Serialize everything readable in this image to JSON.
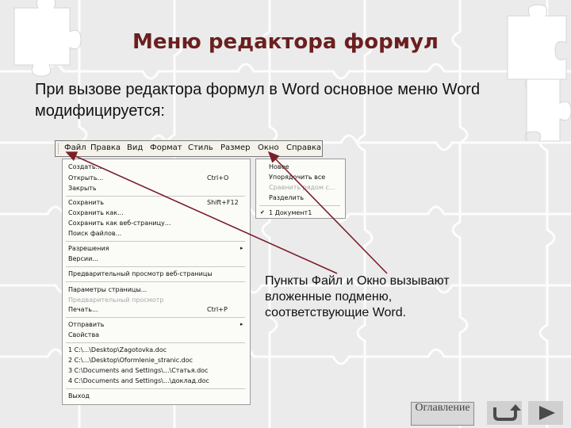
{
  "slide": {
    "title": "Меню редактора формул",
    "intro": "При вызове редактора формул в Word основное меню Word модифицируется:",
    "note": "Пункты Файл и Окно вызывают вложенные подменю, соответствующие Word.",
    "toc_label": "Оглавление",
    "accent_color": "#6b1f1f",
    "arrow_color": "#7a1f2a"
  },
  "menubar": {
    "items": [
      "Файл",
      "Правка",
      "Вид",
      "Формат",
      "Стиль",
      "Размер",
      "Окно",
      "Справка"
    ]
  },
  "file_menu": {
    "items": [
      {
        "label": "Создать..."
      },
      {
        "label": "Открыть...",
        "shortcut": "Ctrl+O"
      },
      {
        "label": "Закрыть"
      },
      {
        "label": "Сохранить",
        "shortcut": "Shift+F12"
      },
      {
        "label": "Сохранить как..."
      },
      {
        "label": "Сохранить как веб-страницу..."
      },
      {
        "label": "Поиск файлов..."
      },
      {
        "label": "Разрешения"
      },
      {
        "label": "Версии..."
      },
      {
        "label": "Предварительный просмотр веб-страницы"
      },
      {
        "label": "Параметры страницы..."
      },
      {
        "label": "Предварительный просмотр",
        "disabled": true
      },
      {
        "label": "Печать...",
        "shortcut": "Ctrl+P"
      },
      {
        "label": "Отправить"
      },
      {
        "label": "Свойства"
      },
      {
        "label": "1 C:\\...\\Desktop\\Zagotovka.doc"
      },
      {
        "label": "2 C:\\...\\Desktop\\Oformlenie_stranic.doc"
      },
      {
        "label": "3 C:\\Documents and Settings\\...\\Статья.doc"
      },
      {
        "label": "4 C:\\Documents and Settings\\...\\доклад.doc"
      },
      {
        "label": "Выход"
      }
    ]
  },
  "window_menu": {
    "items": [
      {
        "label": "Новое"
      },
      {
        "label": "Упорядочить все"
      },
      {
        "label": "Сравнить рядом с...",
        "disabled": true
      },
      {
        "label": "Разделить"
      },
      {
        "label": "1 Документ1",
        "checked": true
      }
    ]
  },
  "icons": {
    "check": "✔",
    "submenu_arrow": "▸",
    "return_icon": "return-arrow-icon",
    "next_icon": "play-triangle-icon"
  }
}
